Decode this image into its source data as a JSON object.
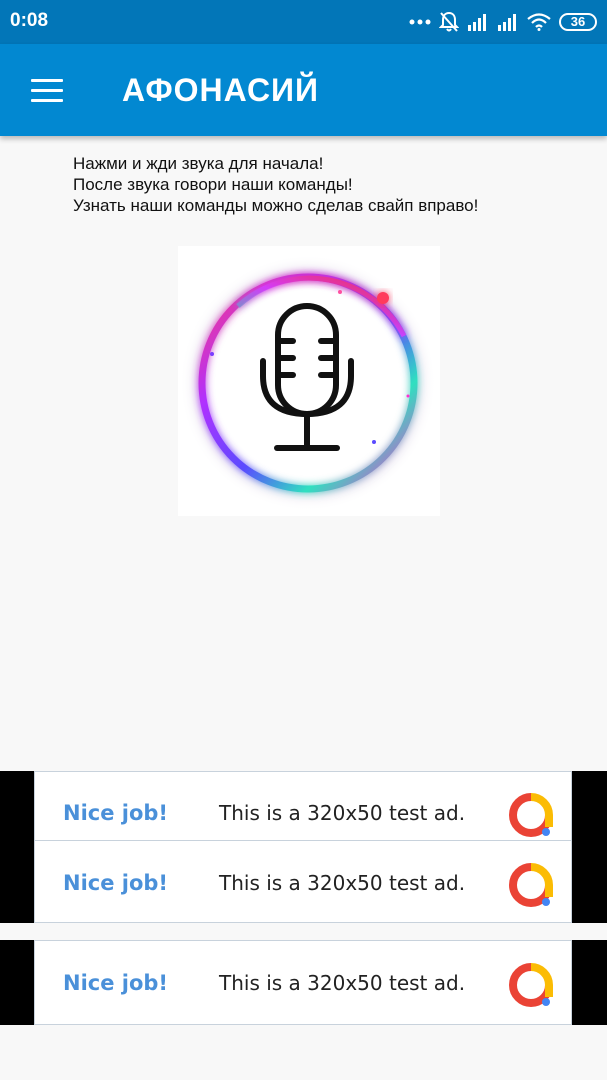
{
  "status_bar": {
    "time": "0:08",
    "battery": "36",
    "icons": [
      "more-dots-icon",
      "notifications-off-icon",
      "signal-icon",
      "signal-icon",
      "wifi-icon",
      "battery-icon"
    ]
  },
  "app_bar": {
    "title": "АФОНАСИЙ",
    "menu_icon": "hamburger-menu-icon"
  },
  "instructions": [
    "Нажми и жди звука для начала!",
    "После звука говори наши команды!",
    "Узнать наши команды можно сделав свайп вправо!"
  ],
  "mic": {
    "icon": "microphone-icon"
  },
  "ads": [
    {
      "headline": "Nice job!",
      "text": "This is a 320x50 test ad.",
      "icon": "ad-choices-icon"
    },
    {
      "headline": "Nice job!",
      "text": "This is a 320x50 test ad.",
      "icon": "ad-choices-icon"
    },
    {
      "headline": "Nice job!",
      "text": "This is a 320x50 test ad.",
      "icon": "ad-choices-icon"
    }
  ],
  "colors": {
    "status_bar": "#0276b8",
    "app_bar": "#0288d1",
    "ad_headline": "#4a90d9",
    "background": "#f8f8f8"
  }
}
